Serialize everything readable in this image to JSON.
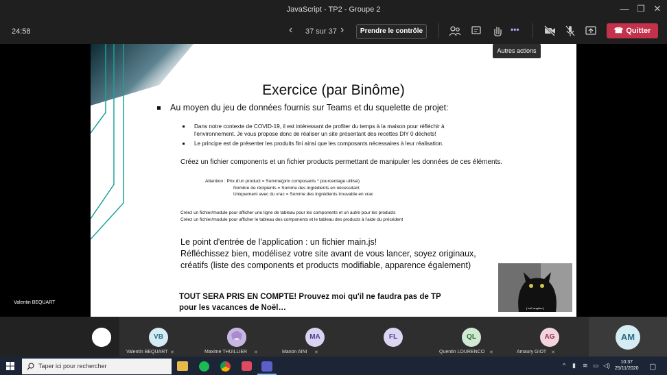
{
  "window": {
    "title": "JavaScript - TP2 - Groupe 2"
  },
  "toolbar": {
    "timer": "24:58",
    "page_counter": "37 sur 37",
    "take_control_label": "Prendre le contrôle",
    "leave_label": "Quitter",
    "more_tooltip": "Autres actions",
    "more_label": "•••"
  },
  "slide": {
    "title": "Exercice (par Binôme)",
    "main_bullet": "Au moyen du jeu de données fournis sur Teams et du squelette de projet:",
    "sub_bullets": [
      "Dans notre contexte de COVID-19, il est intéressant de profiter du temps à la maison pour réfléchir à l'environnement. Je vous propose donc de réaliser un site présentant des recettes DIY 0 déchets!",
      "Le principe est de présenter les produits fini ainsi que les composants nécessaires à leur réalisation."
    ],
    "create_files": "Créez un fichier components et un fichier products permettant de manipuler les données de ces éléments.",
    "attention_lines": [
      "Attention : Prix d'un product = Somme(prix composants * pourcentage utilisé)",
      "Nombre de récipients = Somme des ingrédients en nécessitant",
      "Uniquement avec du vrac = Somme des ingrédients trouvable en vrac"
    ],
    "small_lines": [
      "Créez un fichier/module pour afficher une ligne de tableau pour les components et un autre pour les products",
      "Créez un fichier/module pour afficher le tableau des components et le tableau des products à l'aide du précédent"
    ],
    "big_lines": [
      "Le point d'entrée de l'application : un fichier main.js!",
      "Réfléchissez bien, modélisez votre site avant de vous lancer, soyez originaux,",
      "créatifs (liste des components et products modifiable, apparence également)"
    ],
    "bold_lines": [
      "TOUT SERA PRIS EN COMPTE! Prouvez moi qu'il ne faudra pas de TP",
      "pour les vacances de Noël…"
    ],
    "image_caption": "[ evil laughter ]"
  },
  "speaker_name": "Valentin BEQUART",
  "participants": [
    {
      "initials": "",
      "name": "",
      "color": "#ffffff"
    },
    {
      "initials": "VB",
      "name": "Valentin BEQUART",
      "color": "#d6ecf3"
    },
    {
      "initials": "",
      "name": "Maxime THUILLIER",
      "color": "#c8b6e2"
    },
    {
      "initials": "MA",
      "name": "Manon AINI",
      "color": "#d9d2f0"
    },
    {
      "initials": "FL",
      "name": "",
      "color": "#dcd6f2"
    },
    {
      "initials": "QL",
      "name": "Quentin LOURENCO",
      "color": "#cfe9d2"
    },
    {
      "initials": "AG",
      "name": "Amaury GIOT",
      "color": "#f4d4dc"
    },
    {
      "initials": "AM",
      "name": "",
      "color": "#d6ecf3"
    }
  ],
  "taskbar": {
    "search_placeholder": "Taper ici pour rechercher",
    "time": "10:37",
    "date": "25/11/2020"
  }
}
